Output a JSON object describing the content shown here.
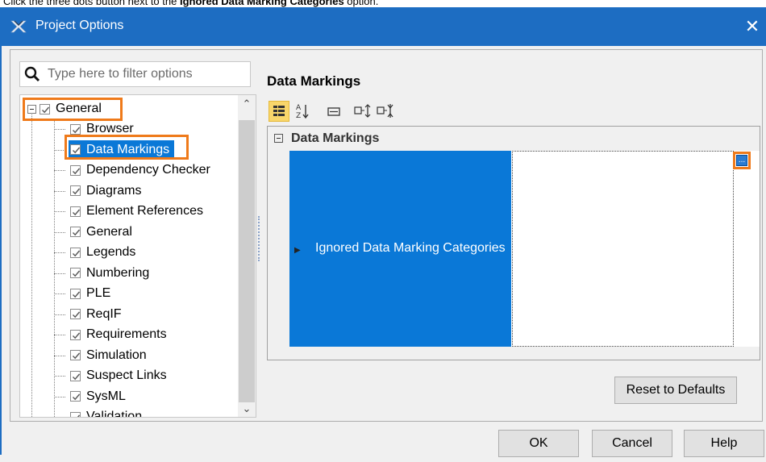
{
  "caption": {
    "prefix": "Click the three dots button next to the ",
    "bold": "Ignored Data Marking Categories",
    "suffix": " option."
  },
  "window": {
    "title": "Project Options",
    "close_symbol": "✕",
    "logo_icon": "cameo-logo-icon"
  },
  "search": {
    "placeholder": "Type here to filter options",
    "value": ""
  },
  "tree": {
    "root_label": "General",
    "items": [
      {
        "label": "Browser",
        "checked": true
      },
      {
        "label": "Data Markings",
        "checked": true,
        "selected": true
      },
      {
        "label": "Dependency Checker",
        "checked": true
      },
      {
        "label": "Diagrams",
        "checked": true
      },
      {
        "label": "Element References",
        "checked": true
      },
      {
        "label": "General",
        "checked": true
      },
      {
        "label": "Legends",
        "checked": true
      },
      {
        "label": "Numbering",
        "checked": true
      },
      {
        "label": "PLE",
        "checked": true
      },
      {
        "label": "ReqIF",
        "checked": true
      },
      {
        "label": "Requirements",
        "checked": true
      },
      {
        "label": "Simulation",
        "checked": true
      },
      {
        "label": "Suspect Links",
        "checked": true
      },
      {
        "label": "SysML",
        "checked": true
      },
      {
        "label": "Validation",
        "checked": true
      }
    ]
  },
  "panel": {
    "title": "Data Markings",
    "group_label": "Data Markings",
    "property_label": "Ignored Data Marking Categories",
    "property_value": "",
    "dots_button": "..."
  },
  "toolbar": {
    "icons": [
      "categorized-icon",
      "sort-alphabetical-icon",
      "description-icon",
      "expand-all-icon",
      "collapse-all-icon"
    ]
  },
  "buttons": {
    "reset": "Reset to Defaults",
    "ok": "OK",
    "cancel": "Cancel",
    "help": "Help"
  },
  "colors": {
    "titlebar": "#1d6dc2",
    "highlight": "#ef7a1a",
    "selection": "#0a78d7"
  }
}
